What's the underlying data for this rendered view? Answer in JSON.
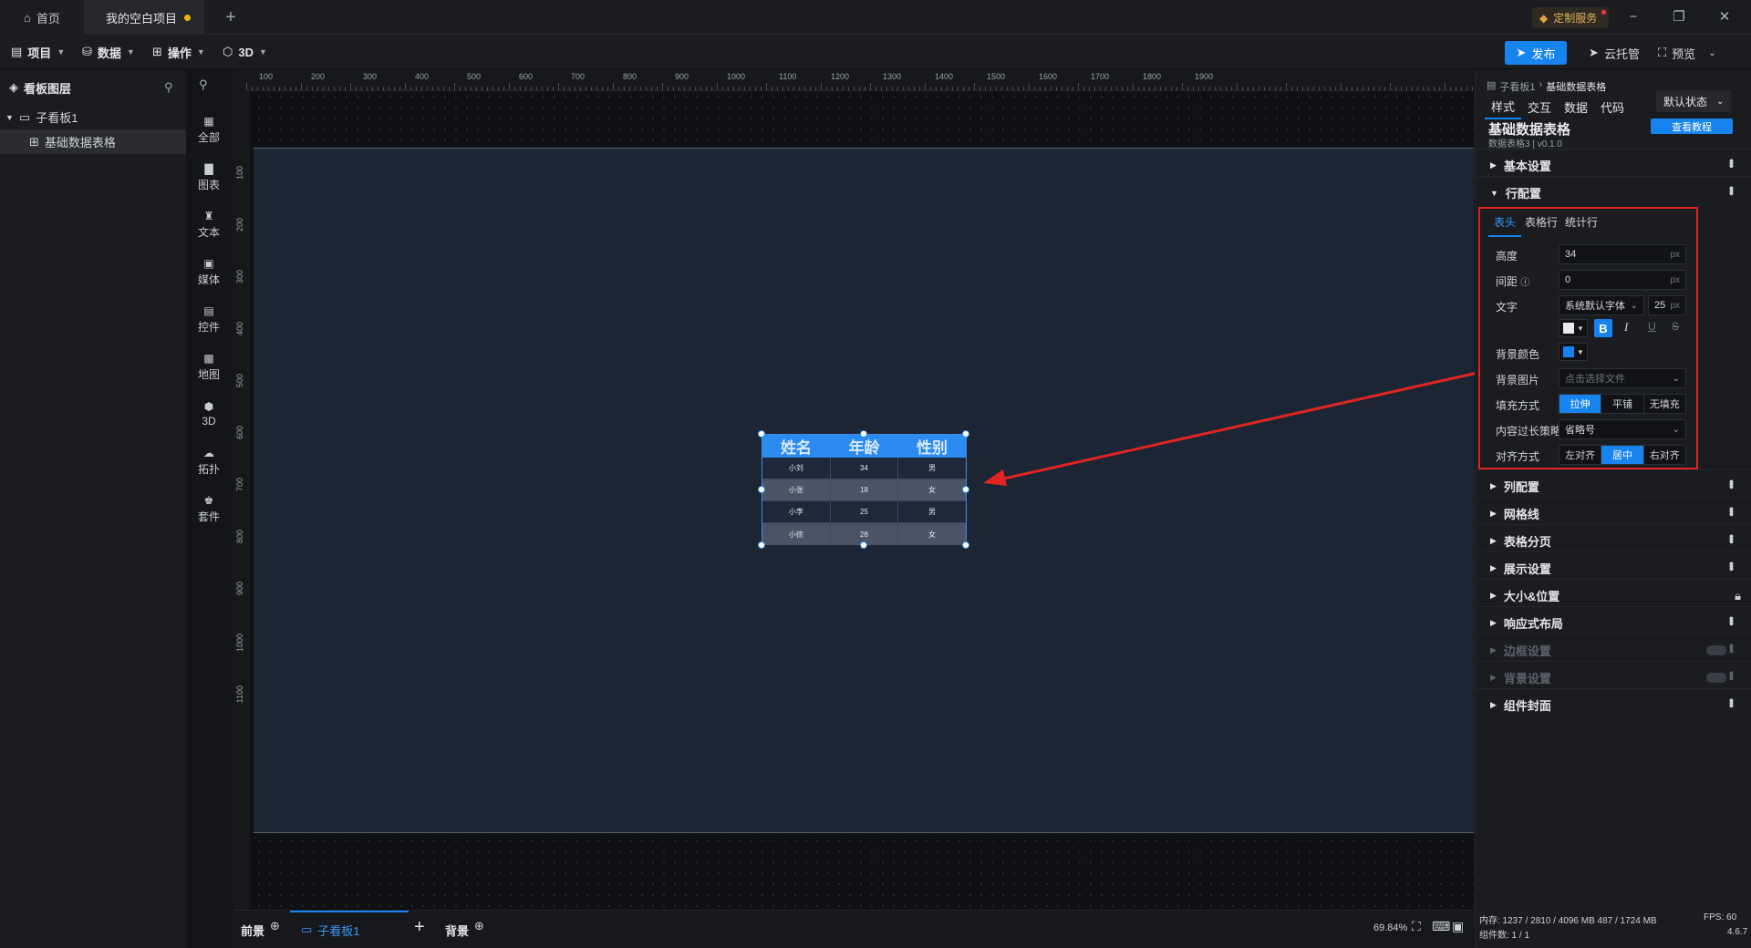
{
  "titlebar": {
    "home_tab": "首页",
    "project_tab": "我的空白项目",
    "custom_service": "定制服务"
  },
  "menubar": {
    "project": "项目",
    "data": "数据",
    "operation": "操作",
    "threed": "3D",
    "publish": "发布",
    "cloud": "云托管",
    "preview": "预览"
  },
  "layers": {
    "title": "看板图层",
    "items": [
      "子看板1",
      "基础数据表格"
    ]
  },
  "iconbar": [
    "全部",
    "图表",
    "文本",
    "媒体",
    "控件",
    "地图",
    "3D",
    "拓扑",
    "套件"
  ],
  "ruler": {
    "top": [
      "100",
      "200",
      "300",
      "400",
      "500",
      "600",
      "700",
      "800",
      "900",
      "1000",
      "1100",
      "1200",
      "1300",
      "1400",
      "1500",
      "1600",
      "1700",
      "1800",
      "1900"
    ],
    "left": [
      "100",
      "200",
      "300",
      "400",
      "500",
      "600",
      "700",
      "800",
      "900",
      "1000",
      "1100"
    ]
  },
  "table": {
    "headers": [
      "姓名",
      "年龄",
      "性别"
    ],
    "rows": [
      [
        "小刘",
        "34",
        "男"
      ],
      [
        "小张",
        "18",
        "女"
      ],
      [
        "小李",
        "25",
        "男"
      ],
      [
        "小徐",
        "28",
        "女"
      ]
    ],
    "colors": {
      "header_bg": "#2b8bf0",
      "row_dark": "#1e2838",
      "row_light": "#4a5466"
    }
  },
  "bottom": {
    "foreground": "前景",
    "board_tab": "子看板1",
    "background": "背景",
    "zoom": "69.84%"
  },
  "panel": {
    "breadcrumb_parent": "子看板1",
    "breadcrumb_current": "基础数据表格",
    "tabs": [
      "样式",
      "交互",
      "数据",
      "代码"
    ],
    "state_select": "默认状态",
    "component_title": "基础数据表格",
    "component_sub": "数据表格3 | v0.1.0",
    "tutorial_btn": "查看教程",
    "sections_top": [
      "基本设置",
      "行配置"
    ],
    "row_tabs": [
      "表头",
      "表格行",
      "统计行"
    ],
    "height_label": "高度",
    "height_value": "34",
    "gap_label": "间距",
    "gap_value": "0",
    "unit": "px",
    "text_label": "文字",
    "font_value": "系统默认字体",
    "font_size": "25",
    "bgcolor_label": "背景颜色",
    "bgimage_label": "背景图片",
    "bgimage_placeholder": "点击选择文件",
    "fill_label": "填充方式",
    "fill_options": [
      "拉伸",
      "平铺",
      "无填充"
    ],
    "overflow_label": "内容过长策略",
    "overflow_value": "省略号",
    "align_label": "对齐方式",
    "align_options": [
      "左对齐",
      "居中",
      "右对齐"
    ],
    "sections_bottom": [
      "列配置",
      "网格线",
      "表格分页",
      "展示设置",
      "大小&位置",
      "响应式布局",
      "边框设置",
      "背景设置",
      "组件封面"
    ],
    "status_mem": "内存: 1237 / 2810 / 4096 MB  487 / 1724 MB",
    "status_fps": "FPS: 60",
    "status_count": "组件数: 1 / 1",
    "version": "4.6.7"
  },
  "colors": {
    "accent": "#1783ef",
    "highlight_box": "#e02424",
    "arrow": "#e02424"
  }
}
